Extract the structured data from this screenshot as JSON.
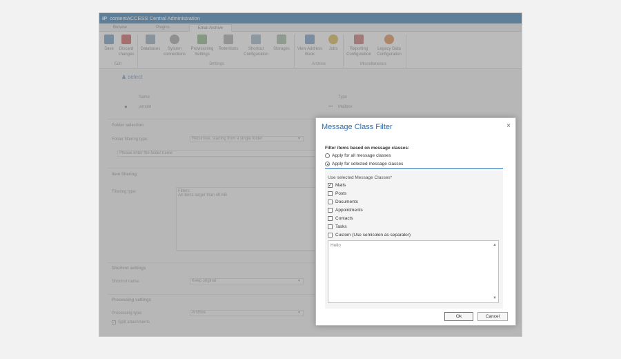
{
  "window": {
    "logo": "IP",
    "title": "contentACCESS Central Administration"
  },
  "ribbon_tabs": [
    "Browse",
    "Plugins",
    "Email Archive"
  ],
  "ribbon": {
    "save": "Save",
    "discard": "Discard changes",
    "edit_group": "Edit",
    "databases": "Databases",
    "system_connections": "System connections",
    "provisioning_settings": "Provisioning Settings",
    "retentions": "Retentions",
    "shortcut_configuration": "Shortcut Configuration",
    "storages": "Storages",
    "settings_group": "Settings",
    "view_address_book": "View Address Book",
    "jobs": "Jobs",
    "archive_group": "Archive",
    "reporting_configuration": "Reporting Configuration",
    "legacy_data_configuration": "Legacy Data Configuration",
    "misc_group": "Miscellaneous"
  },
  "background_form": {
    "select_link": "select",
    "name_header": "Name",
    "type_header": "Type",
    "user_name": "jarnold",
    "user_type": "Mailbox",
    "type_ellipsis": "•••",
    "folder_selection": "Folder selection",
    "folder_filtering_label": "Folder filtering type:",
    "folder_filtering_value": "Recursive, starting from a single folder",
    "folder_name_placeholder": "Please enter the folder name",
    "item_filtering": "Item filtering",
    "filtering_type_label": "Filtering type:",
    "filters_text": "Filters:",
    "filters_value": "All items larger than 40 KB",
    "shortcut_settings": "Shortcut settings",
    "shortcut_name_label": "Shortcut name:",
    "shortcut_name_value": "Keep original",
    "processing_settings": "Processing settings",
    "processing_type_label": "Processing type:",
    "processing_type_value": "Archive",
    "split_attachments": "Split attachments"
  },
  "dialog": {
    "title": "Message Class Filter",
    "close": "×",
    "filter_label": "Filter items based on message classes:",
    "radio_all": "Apply for all message classes",
    "radio_selected": "Apply for selected message classes",
    "radio_selected_on": true,
    "use_selected_label": "Use selected Message Classes*",
    "classes": [
      {
        "label": "Mails",
        "checked": true
      },
      {
        "label": "Posts",
        "checked": false
      },
      {
        "label": "Documents",
        "checked": false
      },
      {
        "label": "Appointments",
        "checked": false
      },
      {
        "label": "Contacts",
        "checked": false
      },
      {
        "label": "Tasks",
        "checked": false
      },
      {
        "label": "Custom (Use semicolon as separator)",
        "checked": false
      }
    ],
    "custom_text": "Hello",
    "ok": "Ok",
    "cancel": "Cancel"
  },
  "colors": {
    "titlebar": "#4a86b4",
    "dialog_title": "#2a6db5"
  }
}
